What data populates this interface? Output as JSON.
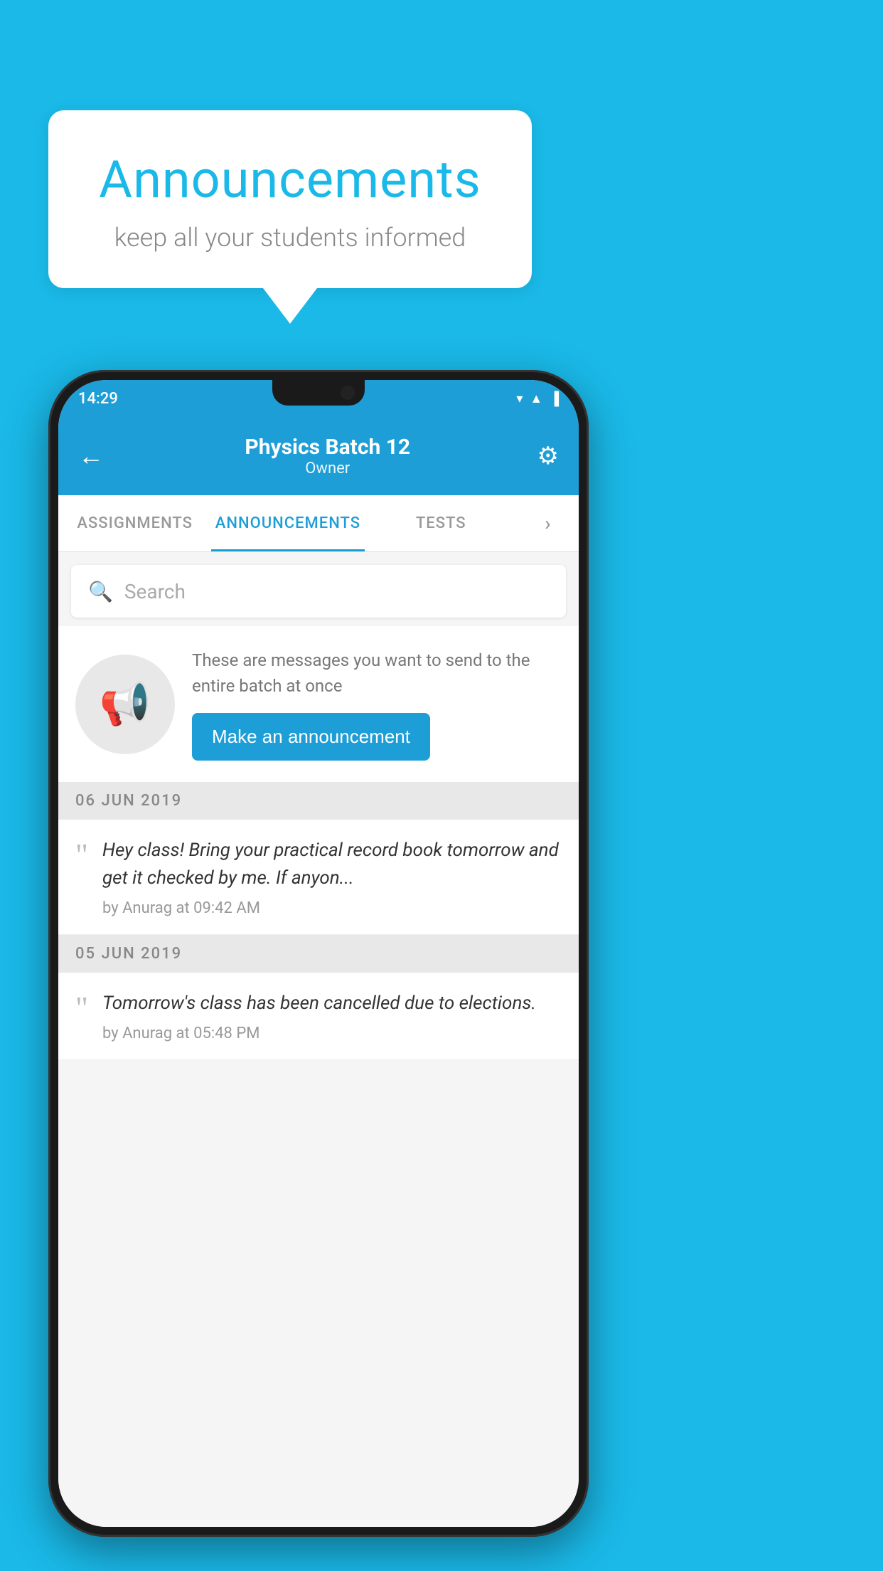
{
  "background_color": "#1ab9e8",
  "speech_bubble": {
    "title": "Announcements",
    "subtitle": "keep all your students informed"
  },
  "phone": {
    "status_bar": {
      "time": "14:29",
      "icons": [
        "wifi",
        "signal",
        "battery"
      ]
    },
    "app_bar": {
      "title": "Physics Batch 12",
      "subtitle": "Owner",
      "back_label": "←",
      "settings_label": "⚙"
    },
    "tabs": [
      {
        "label": "ASSIGNMENTS",
        "active": false
      },
      {
        "label": "ANNOUNCEMENTS",
        "active": true
      },
      {
        "label": "TESTS",
        "active": false
      },
      {
        "label": "···",
        "active": false
      }
    ],
    "search": {
      "placeholder": "Search"
    },
    "promo": {
      "text": "These are messages you want to send to the entire batch at once",
      "button_label": "Make an announcement"
    },
    "announcements": [
      {
        "date": "06  JUN  2019",
        "text": "Hey class! Bring your practical record book tomorrow and get it checked by me. If anyon...",
        "meta": "by Anurag at 09:42 AM"
      },
      {
        "date": "05  JUN  2019",
        "text": "Tomorrow's class has been cancelled due to elections.",
        "meta": "by Anurag at 05:48 PM"
      }
    ]
  }
}
